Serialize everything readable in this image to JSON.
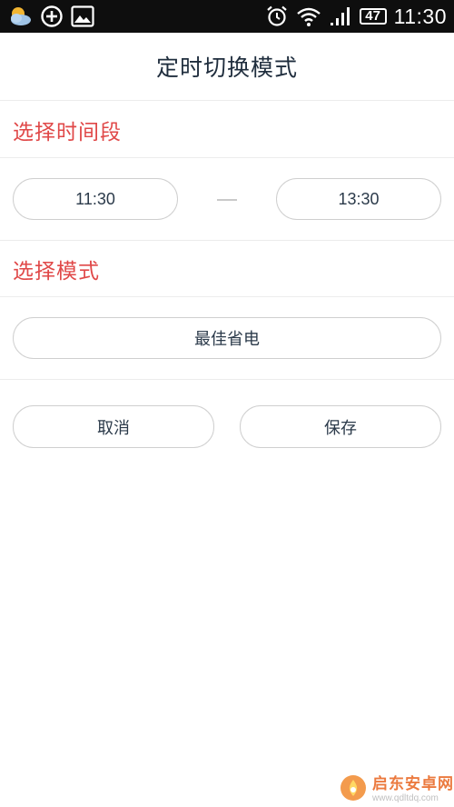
{
  "status_bar": {
    "icons_left": [
      "weather-icon",
      "add-circle-icon",
      "image-icon"
    ],
    "icons_right": [
      "alarm-icon",
      "wifi-icon",
      "signal-icon"
    ],
    "battery": "47",
    "time": "11:30"
  },
  "header": {
    "title": "定时切换模式"
  },
  "time_section": {
    "heading": "选择时间段",
    "start_time": "11:30",
    "end_time": "13:30"
  },
  "mode_section": {
    "heading": "选择模式",
    "selected_mode": "最佳省电"
  },
  "actions": {
    "cancel_label": "取消",
    "save_label": "保存"
  },
  "watermark": {
    "brand": "启东安卓网",
    "url": "www.qdltdq.com"
  },
  "colors": {
    "section_heading": "#e04848",
    "status_bar_bg": "#0e0e0e",
    "pill_border": "#cfcfcf",
    "watermark_brand": "#e8631e"
  }
}
